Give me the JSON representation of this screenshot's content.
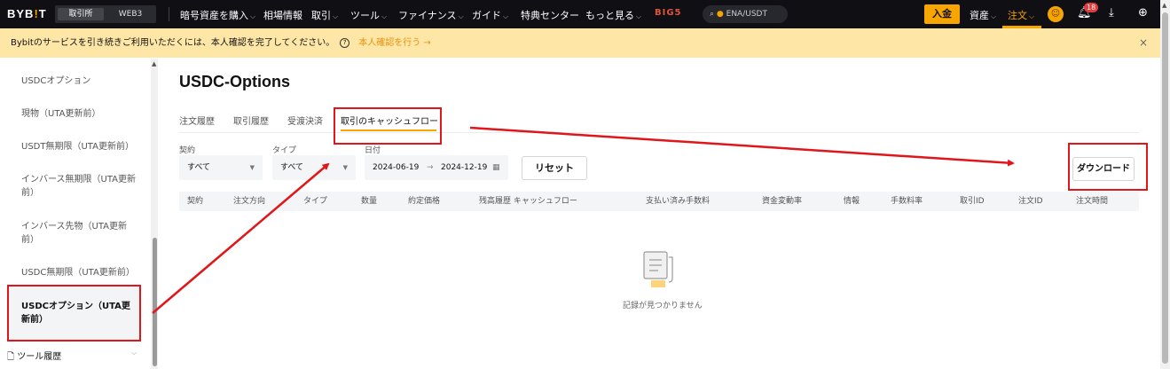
{
  "header": {
    "logo": "BYB",
    "logo_dot": "!",
    "logo_tail": "T",
    "seg_tabs": [
      "取引所",
      "WEB3"
    ],
    "nav": [
      "暗号資産を購入",
      "相場情報",
      "取引",
      "ツール",
      "ファイナンス",
      "ガイド",
      "特典センター",
      "もっと見る"
    ],
    "promo_mark": "BIG5",
    "search_value": "ENA/USDT",
    "deposit_label": "入金",
    "assets_label": "資産",
    "orders_label": "注文",
    "notification_count": "18"
  },
  "banner": {
    "text": "Bybitのサービスを引き続きご利用いただくには、本人確認を完了してください。",
    "link": "本人確認を行う",
    "close": "×"
  },
  "sidebar": {
    "items": [
      "USDCオプション",
      "現物（UTA更新前）",
      "USDT無期限（UTA更新前）",
      "インバース無期限（UTA更新前）",
      "インバース先物（UTA更新前）",
      "USDC無期限（UTA更新前）",
      "USDCオプション（UTA更新前）"
    ],
    "tool_history": "ツール履歴"
  },
  "main": {
    "title": "USDC-Options",
    "tabs": [
      "注文履歴",
      "取引履歴",
      "受渡決済",
      "取引のキャッシュフロー"
    ],
    "active_tab": "取引のキャッシュフロー",
    "filters": {
      "contract_label": "契約",
      "contract_value": "すべて",
      "type_label": "タイプ",
      "type_value": "すべて",
      "date_label": "日付",
      "date_from": "2024-06-19",
      "date_sep": "→",
      "date_to": "2024-12-19"
    },
    "reset_label": "リセット",
    "download_label": "ダウンロード",
    "columns": [
      "契約",
      "注文方向",
      "タイプ",
      "数量",
      "約定価格",
      "残高履歴 キャッシュフロー",
      "支払い済み手数料",
      "資金変動率",
      "情報",
      "手数料率",
      "取引ID",
      "注文ID",
      "注文時間"
    ],
    "empty_text": "記録が見つかりません"
  },
  "colors": {
    "accent": "#f7a600",
    "annotation": "#e0161b",
    "topbar": "#101014",
    "banner": "#fde6a6"
  }
}
